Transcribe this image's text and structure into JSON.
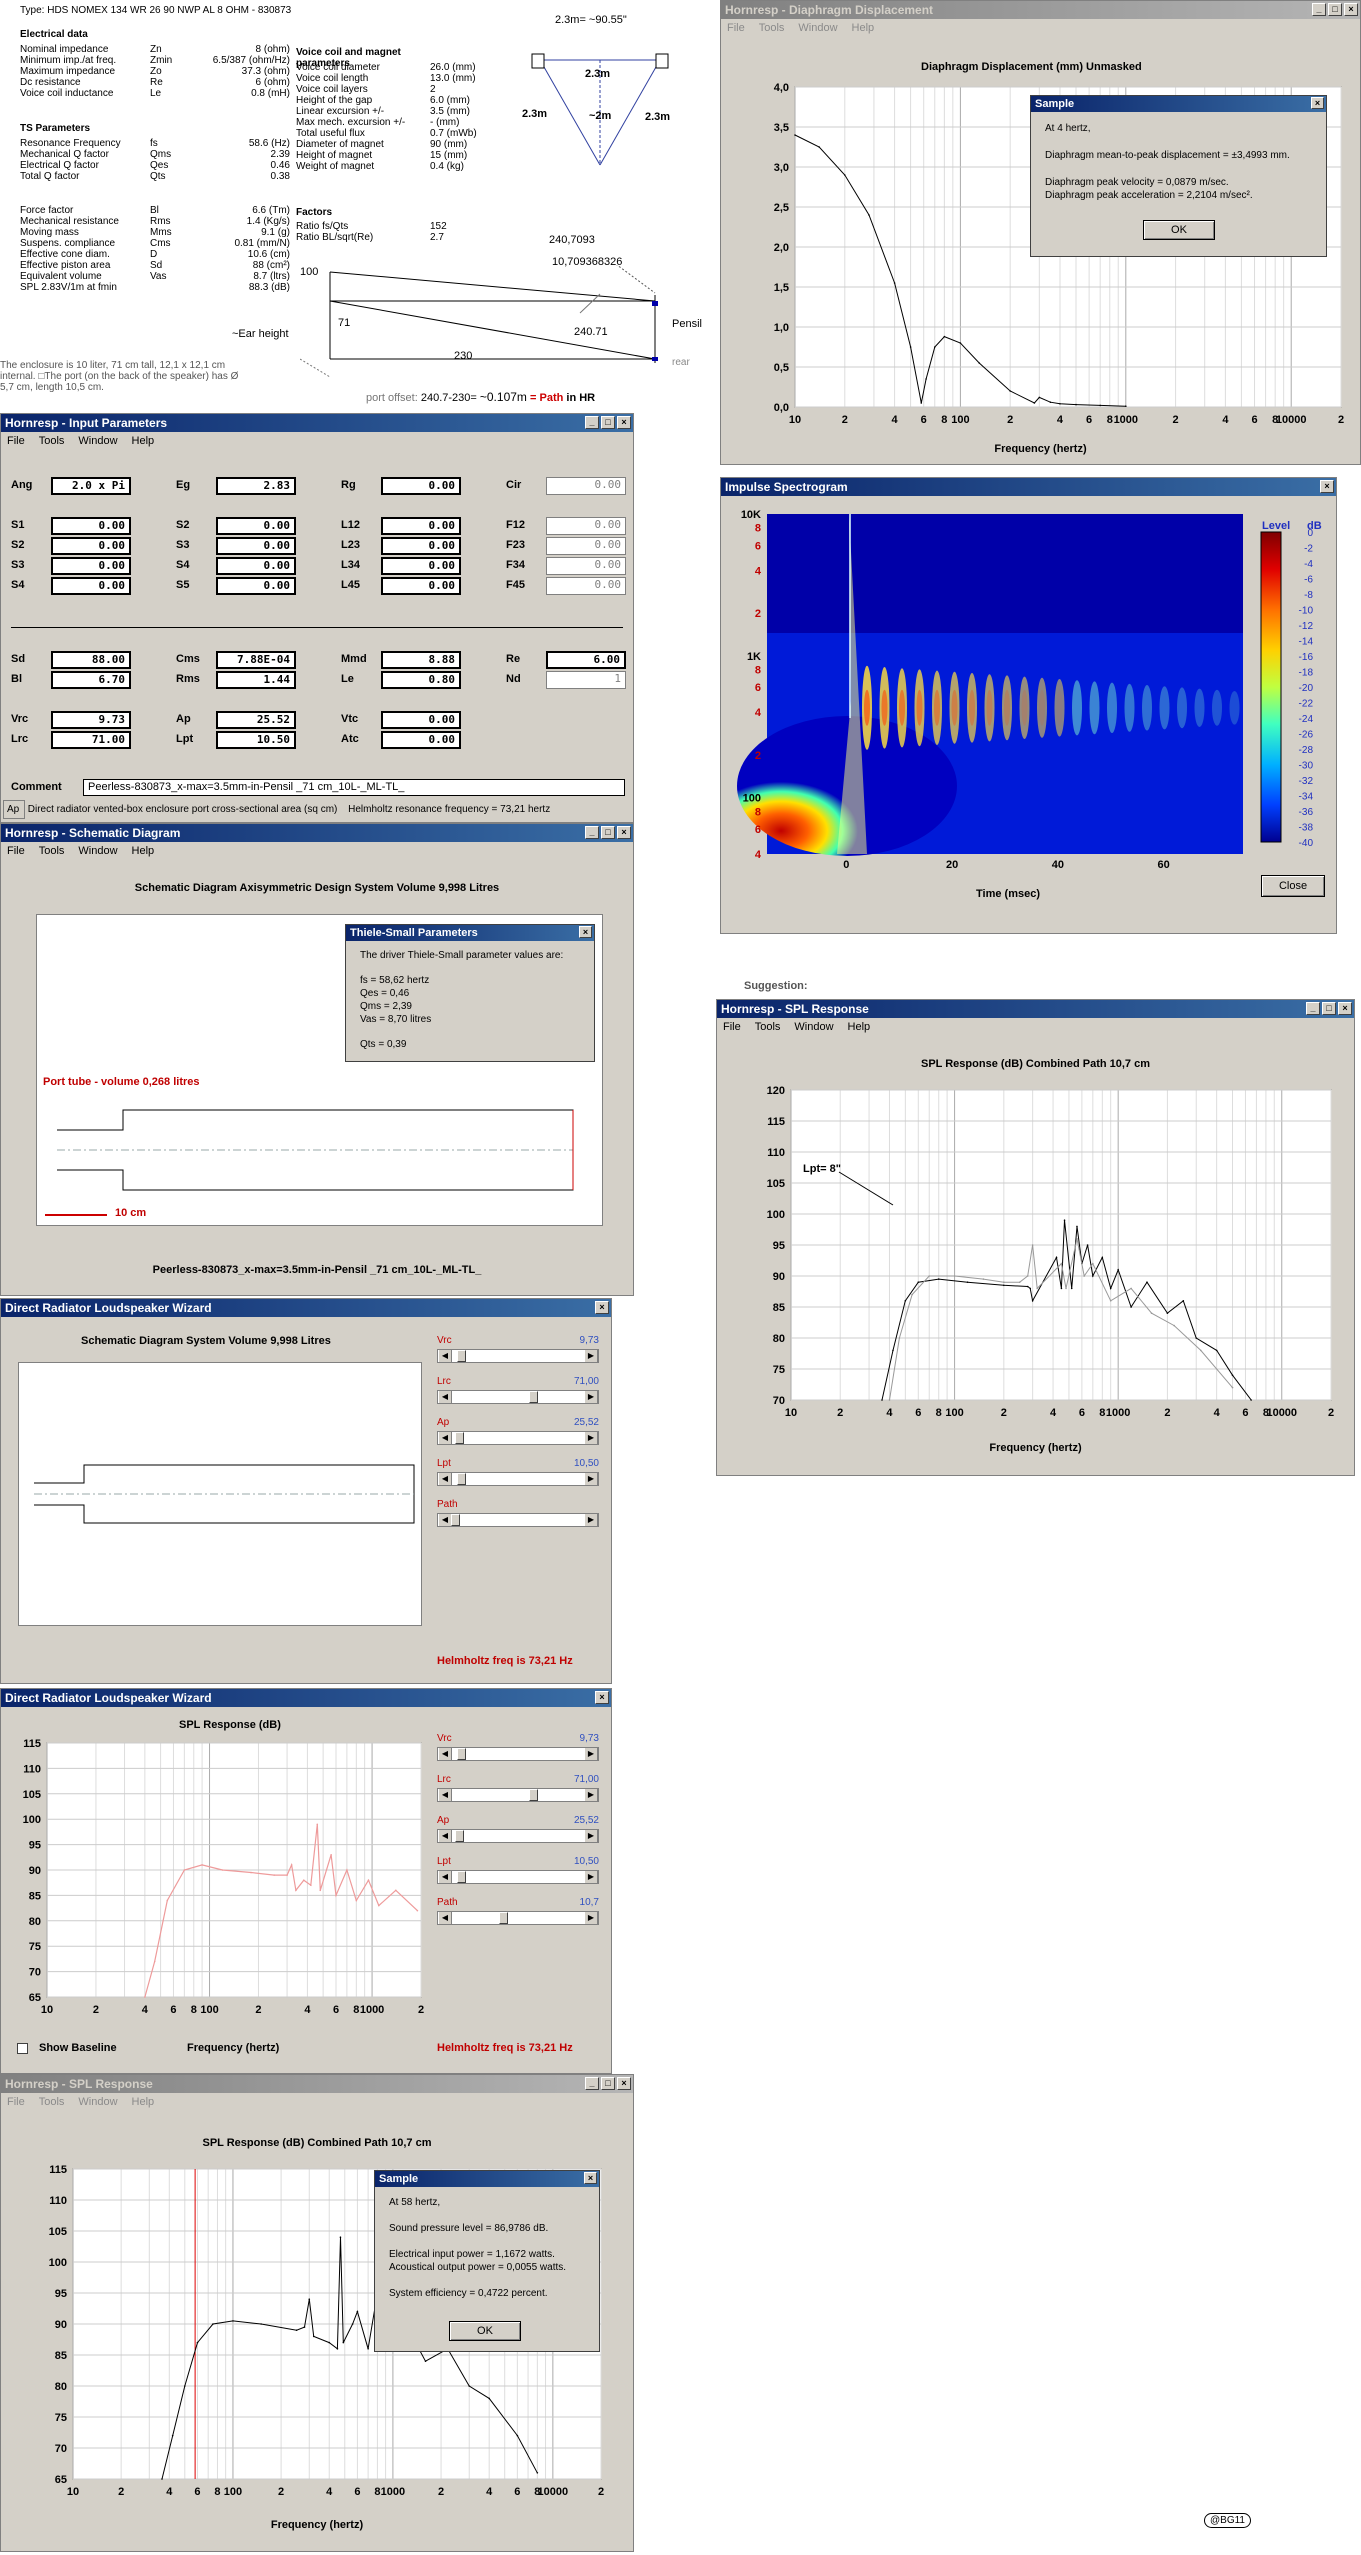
{
  "doc": {
    "type_line": "Type: HDS NOMEX 134 WR 26 90 NWP AL 8 OHM - 830873",
    "electrical_header": "Electrical data",
    "electrical": [
      {
        "name": "Nominal impedance",
        "sym": "Zn",
        "val": "8 (ohm)"
      },
      {
        "name": "Minimum imp./at freq.",
        "sym": "Zmin",
        "val": "6.5/387 (ohm/Hz)"
      },
      {
        "name": "Maximum impedance",
        "sym": "Zo",
        "val": "37.3 (ohm)"
      },
      {
        "name": "Dc resistance",
        "sym": "Re",
        "val": "6 (ohm)"
      },
      {
        "name": "Voice coil inductance",
        "sym": "Le",
        "val": "0.8 (mH)"
      }
    ],
    "ts_header": "TS Parameters",
    "ts": [
      {
        "name": "Resonance Frequency",
        "sym": "fs",
        "val": "58.6 (Hz)"
      },
      {
        "name": "Mechanical Q factor",
        "sym": "Qms",
        "val": "2.39"
      },
      {
        "name": "Electrical Q factor",
        "sym": "Qes",
        "val": "0.46"
      },
      {
        "name": "Total Q factor",
        "sym": "Qts",
        "val": "0.38"
      }
    ],
    "mech": [
      {
        "name": "Force factor",
        "sym": "Bl",
        "val": "6.6 (Tm)"
      },
      {
        "name": "Mechanical resistance",
        "sym": "Rms",
        "val": "1.4 (Kg/s)"
      },
      {
        "name": "Moving mass",
        "sym": "Mms",
        "val": "9.1 (g)"
      },
      {
        "name": "Suspens. compliance",
        "sym": "Cms",
        "val": "0.81 (mm/N)"
      },
      {
        "name": "Effective cone diam.",
        "sym": "D",
        "val": "10.6 (cm)"
      },
      {
        "name": "Effective piston area",
        "sym": "Sd",
        "val": "88 (cm²)"
      },
      {
        "name": "Equivalent volume",
        "sym": "Vas",
        "val": "8.7 (ltrs)"
      },
      {
        "name": "SPL 2.83V/1m at fmin",
        "sym": "",
        "val": "88.3 (dB)"
      }
    ],
    "vc_header": "Voice coil and magnet parameters",
    "vc": [
      {
        "name": "Voice coil diameter",
        "val": "26.0 (mm)"
      },
      {
        "name": "Voice coil length",
        "val": "13.0 (mm)"
      },
      {
        "name": "Voice coil layers",
        "val": "2"
      },
      {
        "name": "Height of the gap",
        "val": "6.0 (mm)"
      },
      {
        "name": "Linear excursion +/-",
        "val": "3.5 (mm)"
      },
      {
        "name": "Max mech. excursion +/-",
        "val": "- (mm)"
      },
      {
        "name": "Total useful flux",
        "val": "0.7 (mWb)"
      },
      {
        "name": "Diameter of magnet",
        "val": "90 (mm)"
      },
      {
        "name": "Height of magnet",
        "val": "15 (mm)"
      },
      {
        "name": "Weight of magnet",
        "val": "0.4 (kg)"
      }
    ],
    "factors_header": "Factors",
    "factors": [
      {
        "name": "Ratio fs/Qts",
        "val": "152"
      },
      {
        "name": "Ratio BL/sqrt(Re)",
        "val": "2.7"
      }
    ],
    "enclosure_note_1": "The enclosure is 10 liter, 71 cm tall, 12,1 x 12,1 cm",
    "enclosure_note_2": "internal. □The port (on the back of the speaker) has Ø",
    "enclosure_note_3": "5,7 cm, length 10,5 cm.",
    "tri_top": "2.3m= ~90.55\"",
    "tri_side_l": "2.3m",
    "tri_side_r": "2.3m",
    "tri_mid": "2.3m",
    "tri_h": "~2m",
    "dim_a": "240,7093",
    "dim_b": "10,709368326",
    "dim_100": "100",
    "dim_71": "71",
    "dim_24071": "240.71",
    "dim_230": "230",
    "ear_label": "~Ear height",
    "pensil_label": "Pensil",
    "rear_label": "rear",
    "port_offset_1": "port offset:",
    "port_offset_2": "240.7-230=",
    "port_offset_3": "~0.107m",
    "port_offset_eq": "=",
    "port_offset_4": "Path",
    "port_offset_5": "in HR",
    "suggestion": "Suggestion:",
    "watermark": "@BG11"
  },
  "input_win": {
    "title": "Hornresp - Input Parameters",
    "menu": [
      "File",
      "Tools",
      "Window",
      "Help"
    ],
    "rows": [
      [
        {
          "l": "Ang",
          "v": "2.0 x Pi"
        },
        {
          "l": "Eg",
          "v": "2.83"
        },
        {
          "l": "Rg",
          "v": "0.00"
        },
        {
          "l": "Cir",
          "v": "0.00",
          "dim": true
        }
      ],
      [
        {
          "l": "S1",
          "v": "0.00"
        },
        {
          "l": "S2",
          "v": "0.00"
        },
        {
          "l": "L12",
          "v": "0.00"
        },
        {
          "l": "F12",
          "v": "0.00",
          "dim": true
        }
      ],
      [
        {
          "l": "S2",
          "v": "0.00"
        },
        {
          "l": "S3",
          "v": "0.00"
        },
        {
          "l": "L23",
          "v": "0.00"
        },
        {
          "l": "F23",
          "v": "0.00",
          "dim": true
        }
      ],
      [
        {
          "l": "S3",
          "v": "0.00"
        },
        {
          "l": "S4",
          "v": "0.00"
        },
        {
          "l": "L34",
          "v": "0.00"
        },
        {
          "l": "F34",
          "v": "0.00",
          "dim": true
        }
      ],
      [
        {
          "l": "S4",
          "v": "0.00"
        },
        {
          "l": "S5",
          "v": "0.00"
        },
        {
          "l": "L45",
          "v": "0.00"
        },
        {
          "l": "F45",
          "v": "0.00",
          "dim": true
        }
      ],
      [
        {
          "l": "Sd",
          "v": "88.00"
        },
        {
          "l": "Cms",
          "v": "7.88E-04"
        },
        {
          "l": "Mmd",
          "v": "8.88"
        },
        {
          "l": "Re",
          "v": "6.00"
        }
      ],
      [
        {
          "l": "Bl",
          "v": "6.70"
        },
        {
          "l": "Rms",
          "v": "1.44"
        },
        {
          "l": "Le",
          "v": "0.80"
        },
        {
          "l": "Nd",
          "v": "1",
          "dim": true
        }
      ],
      [
        {
          "l": "Vrc",
          "v": "9.73"
        },
        {
          "l": "Ap",
          "v": "25.52"
        },
        {
          "l": "Vtc",
          "v": "0.00"
        },
        {
          "l": "",
          "v": ""
        }
      ],
      [
        {
          "l": "Lrc",
          "v": "71.00"
        },
        {
          "l": "Lpt",
          "v": "10.50"
        },
        {
          "l": "Atc",
          "v": "0.00"
        },
        {
          "l": "",
          "v": ""
        }
      ]
    ],
    "comment_label": "Comment",
    "comment_value": "Peerless-830873_x-max=3.5mm-in-Pensil _71 cm_10L-_ML-TL_",
    "status_left": "Ap",
    "status_mid": "Direct radiator vented-box enclosure port cross-sectional area (sq cm)",
    "status_right": "Helmholtz resonance frequency = 73,21 hertz"
  },
  "schem_win": {
    "title": "Hornresp - Schematic Diagram",
    "menu": [
      "File",
      "Tools",
      "Window",
      "Help"
    ],
    "heading": "Schematic Diagram   Axisymmetric Design   System Volume 9,998 Litres",
    "port_label": "Port tube - volume 0,268 litres",
    "scale_label": "10 cm",
    "footer": "Peerless-830873_x-max=3.5mm-in-Pensil _71 cm_10L-_ML-TL_",
    "ts_dialog": {
      "title": "Thiele-Small Parameters",
      "line1": "The driver Thiele-Small parameter values are:",
      "fs": "fs = 58,62 hertz",
      "qes": "Qes = 0,46",
      "qms": "Qms = 2,39",
      "vas": "Vas = 8,70 litres",
      "qts": "Qts = 0,39"
    }
  },
  "wiz1": {
    "title": "Direct Radiator Loudspeaker Wizard",
    "heading": "Schematic Diagram   System Volume 9,998 Litres",
    "sliders": [
      {
        "label": "Vrc",
        "value": "9,73",
        "pos": 0.05
      },
      {
        "label": "Lrc",
        "value": "71,00",
        "pos": 0.62
      },
      {
        "label": "Ap",
        "value": "25,52",
        "pos": 0.03
      },
      {
        "label": "Lpt",
        "value": "10,50",
        "pos": 0.05
      },
      {
        "label": "Path",
        "value": "",
        "pos": 0.0
      }
    ],
    "helmholtz": "Helmholtz freq is 73,21 Hz"
  },
  "wiz2": {
    "title": "Direct Radiator Loudspeaker Wizard",
    "heading": "SPL Response (dB)",
    "sliders": [
      {
        "label": "Vrc",
        "value": "9,73",
        "pos": 0.05
      },
      {
        "label": "Lrc",
        "value": "71,00",
        "pos": 0.62
      },
      {
        "label": "Ap",
        "value": "25,52",
        "pos": 0.03
      },
      {
        "label": "Lpt",
        "value": "10,50",
        "pos": 0.05
      },
      {
        "label": "Path",
        "value": "10,7",
        "pos": 0.38
      }
    ],
    "xlabel": "Frequency (hertz)",
    "show_baseline": "Show Baseline",
    "helmholtz": "Helmholtz freq is 73,21 Hz"
  },
  "spl_bottom": {
    "title": "Hornresp - SPL Response",
    "menu": [
      "File",
      "Tools",
      "Window",
      "Help"
    ],
    "heading": "SPL Response (dB)   Combined   Path 10,7 cm",
    "xlabel": "Frequency (hertz)",
    "sample": {
      "title": "Sample",
      "l1": "At 58 hertz,",
      "l2": "Sound pressure level = 86,9786 dB.",
      "l3": "Electrical input power = 1,1672 watts.",
      "l4": "Acoustical output power = 0,0055 watts.",
      "l5": "System efficiency = 0,4722 percent.",
      "ok": "OK"
    }
  },
  "disp_win": {
    "title": "Hornresp - Diaphragm Displacement",
    "menu": [
      "File",
      "Tools",
      "Window",
      "Help"
    ],
    "heading": "Diaphragm Displacement (mm)   Unmasked",
    "xlabel": "Frequency (hertz)",
    "sample": {
      "title": "Sample",
      "l1": "At 4 hertz,",
      "l2": "Diaphragm mean-to-peak displacement = ±3,4993 mm.",
      "l3": "Diaphragm peak velocity = 0,0879 m/sec.",
      "l4": "Diaphragm peak acceleration = 2,2104 m/sec².",
      "ok": "OK"
    }
  },
  "impulse_win": {
    "title": "Impulse Spectrogram",
    "xlabel": "Time (msec)",
    "level_label": "Level",
    "db_label": "dB",
    "close": "Close"
  },
  "spl_right": {
    "title": "Hornresp - SPL Response",
    "menu": [
      "File",
      "Tools",
      "Window",
      "Help"
    ],
    "heading": "SPL Response (dB)   Combined   Path 10,7 cm",
    "xlabel": "Frequency (hertz)",
    "annotation": "Lpt= 8\""
  },
  "chart_data": [
    {
      "type": "line",
      "title": "Diaphragm Displacement (mm)   Unmasked",
      "xlabel": "Frequency (hertz)",
      "ylabel": "",
      "x_scale": "log",
      "xlim": [
        10,
        20000
      ],
      "ylim": [
        0,
        4
      ],
      "yticks": [
        "0,0",
        "0,5",
        "1,0",
        "1,5",
        "2,0",
        "2,5",
        "3,0",
        "3,5",
        "4,0"
      ],
      "xticks": [
        "10",
        "2",
        "4",
        "6",
        "8",
        "100",
        "2",
        "4",
        "6",
        "8",
        "1000",
        "2",
        "4",
        "6",
        "8",
        "10000",
        "2"
      ],
      "series": [
        {
          "x": [
            10,
            14,
            20,
            28,
            40,
            50,
            58,
            62,
            70,
            80,
            100,
            130,
            200,
            280,
            300,
            350,
            400,
            500,
            700,
            1000
          ],
          "values": [
            3.4,
            3.25,
            2.9,
            2.4,
            1.55,
            0.75,
            0.05,
            0.35,
            0.75,
            0.88,
            0.8,
            0.55,
            0.2,
            0.05,
            0.12,
            0.06,
            0.04,
            0.03,
            0.02,
            0.01
          ]
        }
      ]
    },
    {
      "type": "heatmap",
      "title": "Impulse Spectrogram",
      "xlabel": "Time (msec)",
      "ylabel": "",
      "xlim": [
        -15,
        75
      ],
      "yscale": "log",
      "ylim": [
        40,
        10000
      ],
      "xticks": [
        "0",
        "20",
        "40",
        "60"
      ],
      "yticks": [
        "10K",
        "8",
        "6",
        "4",
        "2",
        "1K",
        "8",
        "6",
        "4",
        "2",
        "100",
        "8",
        "6",
        "4"
      ],
      "colorbar": {
        "label": "Level dB",
        "ticks": [
          "0",
          "-2",
          "-4",
          "-6",
          "-8",
          "-10",
          "-12",
          "-14",
          "-16",
          "-18",
          "-20",
          "-22",
          "-24",
          "-26",
          "-28",
          "-30",
          "-32",
          "-34",
          "-36",
          "-38",
          "-40"
        ]
      }
    },
    {
      "type": "line",
      "title": "SPL Response (dB)   Combined   Path 10,7 cm",
      "xlabel": "Frequency (hertz)",
      "x_scale": "log",
      "xlim": [
        10,
        20000
      ],
      "ylim": [
        70,
        120
      ],
      "yticks": [
        "70",
        "75",
        "80",
        "85",
        "90",
        "95",
        "100",
        "105",
        "110",
        "115",
        "120"
      ],
      "xticks": [
        "10",
        "2",
        "4",
        "6",
        "8",
        "100",
        "2",
        "4",
        "6",
        "8",
        "1000",
        "2",
        "4",
        "6",
        "8",
        "10000",
        "2"
      ],
      "series": [
        {
          "values": [
            70,
            78,
            86,
            89,
            89.5,
            89,
            88.5,
            88.3,
            88,
            86,
            93,
            88,
            99,
            88,
            98,
            92,
            95,
            90,
            93,
            88,
            91,
            85,
            89,
            84,
            86,
            80,
            78,
            74,
            70
          ],
          "x": [
            36,
            42,
            50,
            60,
            80,
            120,
            200,
            280,
            290,
            300,
            420,
            450,
            470,
            520,
            560,
            600,
            650,
            700,
            800,
            900,
            1000,
            1200,
            1500,
            2000,
            2500,
            3000,
            4000,
            5000,
            6500
          ]
        },
        {
          "values": [
            70,
            80,
            87,
            90,
            90,
            89.5,
            89,
            89,
            90,
            95,
            88,
            92,
            88,
            96,
            90,
            92,
            86,
            88,
            84,
            82,
            78,
            72
          ],
          "x": [
            40,
            46,
            55,
            70,
            100,
            150,
            200,
            250,
            280,
            300,
            320,
            450,
            480,
            560,
            620,
            700,
            900,
            1200,
            1600,
            2200,
            3200,
            5000
          ]
        }
      ],
      "annotation": "Lpt= 8\""
    },
    {
      "type": "line",
      "title": "SPL Response (dB)",
      "xlabel": "Frequency (hertz)",
      "x_scale": "log",
      "xlim": [
        10,
        2000
      ],
      "ylim": [
        65,
        115
      ],
      "yticks": [
        "65",
        "70",
        "75",
        "80",
        "85",
        "90",
        "95",
        "100",
        "105",
        "110",
        "115"
      ],
      "xticks": [
        "10",
        "2",
        "4",
        "6",
        "8",
        "100",
        "2",
        "4",
        "6",
        "8",
        "1000",
        "2"
      ],
      "series": [
        {
          "values": [
            65,
            72,
            84,
            90,
            91,
            90,
            89.5,
            89,
            89,
            91,
            86,
            88,
            87,
            99,
            86,
            93,
            85,
            90,
            84,
            88,
            83,
            86,
            82
          ],
          "x": [
            40,
            46,
            55,
            70,
            90,
            120,
            180,
            250,
            300,
            320,
            340,
            380,
            420,
            460,
            480,
            560,
            600,
            700,
            800,
            950,
            1100,
            1400,
            1900
          ]
        }
      ]
    },
    {
      "type": "line",
      "title": "SPL Response (dB)   Combined   Path 10,7 cm",
      "xlabel": "Frequency (hertz)",
      "x_scale": "log",
      "xlim": [
        10,
        20000
      ],
      "ylim": [
        65,
        115
      ],
      "yticks": [
        "65",
        "70",
        "75",
        "80",
        "85",
        "90",
        "95",
        "100",
        "105",
        "110",
        "115"
      ],
      "xticks": [
        "10",
        "2",
        "4",
        "6",
        "8",
        "100",
        "2",
        "4",
        "6",
        "8",
        "1000",
        "2",
        "4",
        "6",
        "8",
        "10000",
        "2"
      ],
      "series": [
        {
          "values": [
            65,
            72,
            80,
            87,
            90,
            90.5,
            90,
            89,
            89.5,
            94,
            88,
            87,
            86,
            104,
            87,
            90,
            92,
            86,
            95,
            86,
            90,
            84,
            86,
            80,
            78,
            72,
            66
          ],
          "x": [
            36,
            42,
            50,
            60,
            75,
            100,
            150,
            250,
            280,
            300,
            320,
            400,
            450,
            470,
            490,
            560,
            600,
            700,
            800,
            1000,
            1200,
            1600,
            2200,
            3000,
            4000,
            6000,
            8000
          ]
        }
      ],
      "marker_x": 58
    }
  ]
}
